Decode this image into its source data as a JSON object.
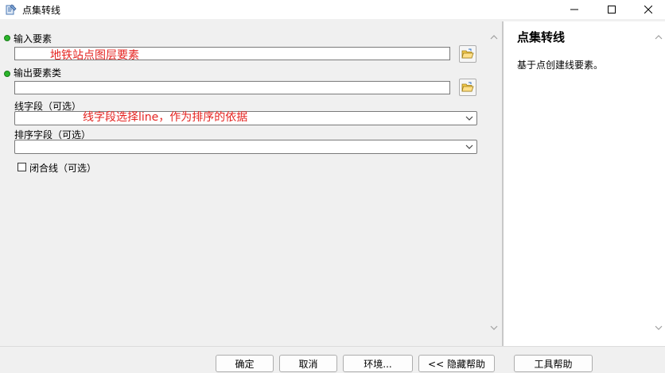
{
  "window": {
    "title": "点集转线",
    "icon": "toolbox-icon"
  },
  "form": {
    "input_features": {
      "label": "输入要素",
      "value": "",
      "annotation": "地铁站点图层要素"
    },
    "output_feature_class": {
      "label": "输出要素类",
      "value": ""
    },
    "line_field": {
      "label": "线字段（可选）",
      "value": "",
      "annotation": "线字段选择line，作为排序的依据"
    },
    "sort_field": {
      "label": "排序字段（可选）",
      "value": ""
    },
    "close_line": {
      "label": "闭合线（可选）",
      "checked": false
    }
  },
  "help": {
    "title": "点集转线",
    "description": "基于点创建线要素。"
  },
  "buttons": {
    "ok": "确定",
    "cancel": "取消",
    "environments": "环境...",
    "hide_help": "<< 隐藏帮助",
    "tool_help": "工具帮助"
  },
  "colors": {
    "required_dot": "#2bb52b",
    "annotation": "#e52421"
  }
}
